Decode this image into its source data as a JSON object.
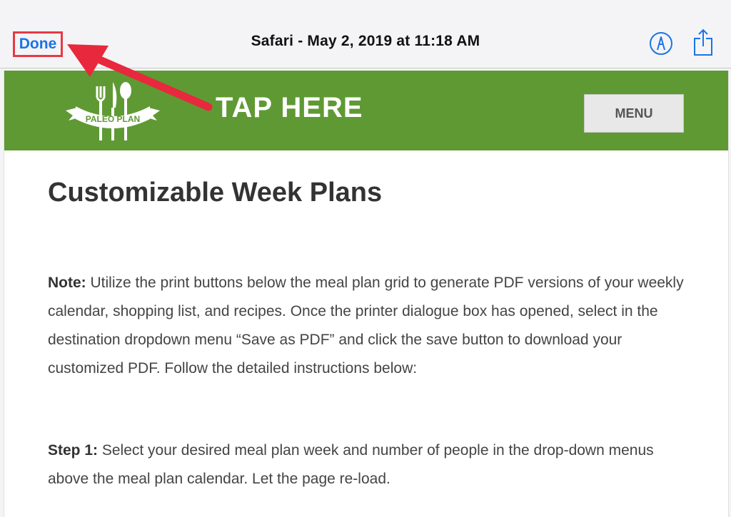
{
  "topbar": {
    "done_label": "Done",
    "title": "Safari - May 2, 2019 at 11:18 AM",
    "markup_icon": "markup-pen-icon",
    "share_icon": "share-icon"
  },
  "banner": {
    "logo_text": "PALEO PLAN",
    "annotation": "TAP HERE",
    "menu_label": "MENU",
    "color": "#5f9934"
  },
  "content": {
    "heading": "Customizable Week Plans",
    "note_label": "Note:",
    "note_text": " Utilize the print buttons below the meal plan grid to generate PDF versions of your weekly calendar, shopping list, and recipes. Once the printer dialogue box has opened, select in the destination dropdown menu “Save as PDF” and click the save button to download your customized PDF. Follow the detailed instructions below:",
    "step1_label": "Step 1:",
    "step1_text": " Select your desired meal plan week and number of people in the drop-down menus above the meal plan calendar. Let the page re-load."
  },
  "annotation": {
    "arrow_color": "#e8283c",
    "highlight_color": "#e63946"
  }
}
